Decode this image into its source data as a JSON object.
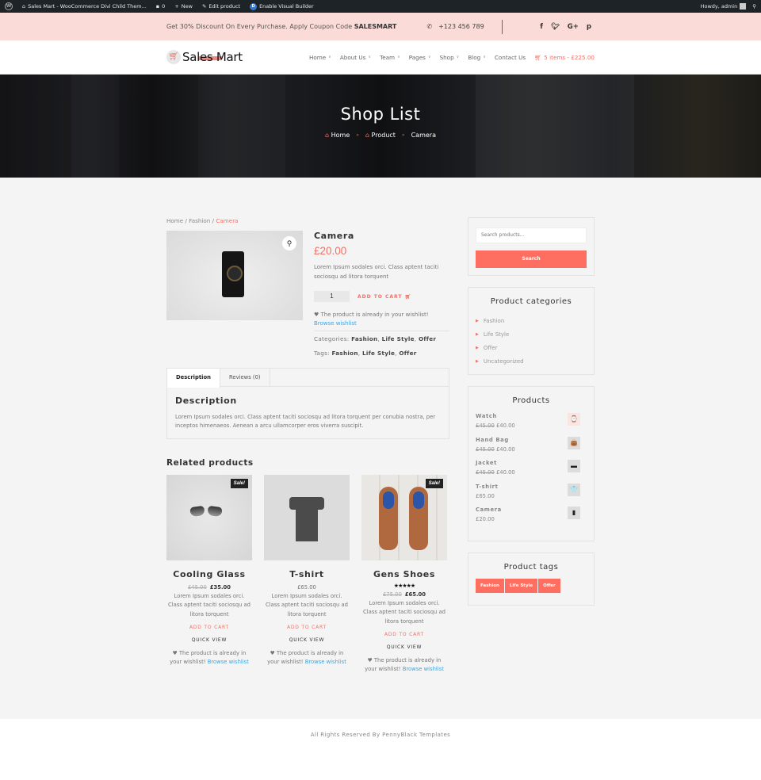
{
  "admin_bar": {
    "site_name": "Sales Mart - WooCommerce Divi Child Them...",
    "comments_count": "0",
    "new_label": "New",
    "edit_label": "Edit product",
    "visual_builder_label": "Enable Visual Builder",
    "greeting": "Howdy, admin"
  },
  "top_bar": {
    "promo_text": "Get 30% Discount On Every Purchase. Apply Coupon Code",
    "coupon_code": "SALESMART",
    "phone": "+123 456 789",
    "social": [
      "f",
      "t",
      "G+",
      "p"
    ]
  },
  "header": {
    "logo_text": "Sales Mart",
    "nav": [
      {
        "label": "Home",
        "has_dropdown": true
      },
      {
        "label": "About Us",
        "has_dropdown": true
      },
      {
        "label": "Team",
        "has_dropdown": true
      },
      {
        "label": "Pages",
        "has_dropdown": true
      },
      {
        "label": "Shop",
        "has_dropdown": true
      },
      {
        "label": "Blog",
        "has_dropdown": true
      },
      {
        "label": "Contact Us",
        "has_dropdown": false
      }
    ],
    "cart_label": "5 items - £225.00"
  },
  "hero": {
    "title": "Shop List",
    "breadcrumb": [
      "Home",
      "Product",
      "Camera"
    ]
  },
  "product": {
    "breadcrumb": {
      "home": "Home",
      "category": "Fashion",
      "current": "Camera"
    },
    "title": "Camera",
    "price": "£20.00",
    "short_description": "Lorem Ipsum sodales orci. Class aptent taciti sociosqu ad litora torquent",
    "quantity": "1",
    "add_to_cart": "ADD TO CART",
    "wishlist_text": "The product is already in your wishlist!",
    "wishlist_link": "Browse wishlist",
    "categories_label": "Categories:",
    "categories": [
      "Fashion",
      "Life Style",
      "Offer"
    ],
    "tags_label": "Tags:",
    "tags": [
      "Fashion",
      "Life Style",
      "Offer"
    ]
  },
  "tabs": {
    "items": [
      "Description",
      "Reviews (0)"
    ],
    "active": "Description",
    "heading": "Description",
    "body": "Lorem Ipsum sodales orci. Class aptent taciti sociosqu ad litora torquent per conubia nostra, per inceptos himenaeos. Aenean a arcu ullamcorper eros viverra suscipit."
  },
  "related": {
    "title": "Related products",
    "items": [
      {
        "name": "Cooling Glass",
        "sale_badge": "Sale!",
        "old_price": "£45.00",
        "price": "£35.00",
        "rating": null,
        "description": "Lorem Ipsum sodales orci. Class aptent taciti sociosqu ad litora torquent",
        "add_to_cart": "ADD TO CART",
        "quick_view": "QUICK VIEW",
        "wishlist_text": "The product is already in your wishlist!",
        "wishlist_link": "Browse wishlist"
      },
      {
        "name": "T-shirt",
        "sale_badge": null,
        "old_price": null,
        "price": "£65.00",
        "rating": null,
        "description": "Lorem Ipsum sodales orci. Class aptent taciti sociosqu ad litora torquent",
        "add_to_cart": "ADD TO CART",
        "quick_view": "QUICK VIEW",
        "wishlist_text": "The product is already in your wishlist!",
        "wishlist_link": "Browse wishlist"
      },
      {
        "name": "Gens Shoes",
        "sale_badge": "Sale!",
        "old_price": "£75.00",
        "price": "£65.00",
        "rating": "★★★★★",
        "description": "Lorem Ipsum sodales orci. Class aptent taciti sociosqu ad litora torquent",
        "add_to_cart": "ADD TO CART",
        "quick_view": "QUICK VIEW",
        "wishlist_text": "The product is already in your wishlist!",
        "wishlist_link": "Browse wishlist"
      }
    ]
  },
  "sidebar": {
    "search": {
      "placeholder": "Search products...",
      "button": "Search"
    },
    "categories": {
      "title": "Product categories",
      "items": [
        "Fashion",
        "Life Style",
        "Offer",
        "Uncategorized"
      ]
    },
    "products": {
      "title": "Products",
      "items": [
        {
          "name": "Watch",
          "old_price": "£45.00",
          "price": "£40.00",
          "icon": "⌚"
        },
        {
          "name": "Hand Bag",
          "old_price": "£45.00",
          "price": "£40.00",
          "icon": "👜"
        },
        {
          "name": "Jacket",
          "old_price": "£45.00",
          "price": "£40.00",
          "icon": "▬"
        },
        {
          "name": "T-shirt",
          "old_price": null,
          "price": "£65.00",
          "icon": "👕"
        },
        {
          "name": "Camera",
          "old_price": null,
          "price": "£20.00",
          "icon": "▮"
        }
      ]
    },
    "tags": {
      "title": "Product tags",
      "items": [
        "Fashion",
        "Life Style",
        "Offer"
      ]
    }
  },
  "footer": {
    "text": "All Rights Reserved By PennyBlack Templates"
  },
  "colors": {
    "accent": "#ff6f61",
    "topbar_bg": "#fbdbd7",
    "link": "#3ea5e0",
    "admin_bar": "#1d2327"
  }
}
